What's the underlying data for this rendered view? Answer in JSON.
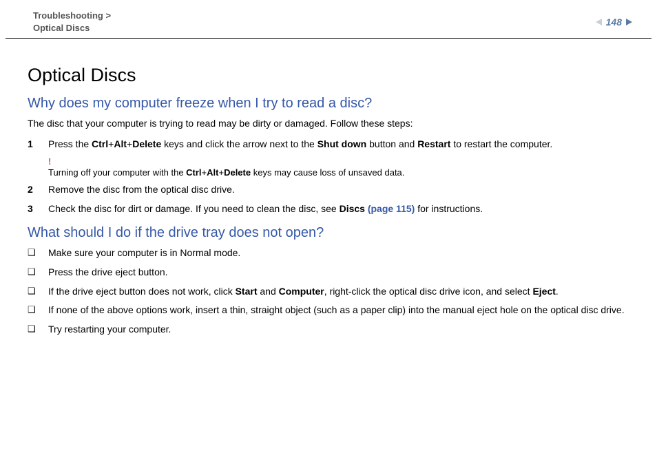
{
  "header": {
    "breadcrumb_parent": "Troubleshooting",
    "breadcrumb_sep": " >",
    "breadcrumb_current": "Optical Discs",
    "page_number": "148"
  },
  "section_title": "Optical Discs",
  "q1": {
    "heading": "Why does my computer freeze when I try to read a disc?",
    "intro": "The disc that your computer is trying to read may be dirty or damaged. Follow these steps:",
    "steps": {
      "s1": {
        "num": "1",
        "pre": "Press the ",
        "k1": "Ctrl",
        "plus1": "+",
        "k2": "Alt",
        "plus2": "+",
        "k3": "Delete",
        "mid1": " keys and click the arrow next to the ",
        "b1": "Shut down",
        "mid2": " button and ",
        "b2": "Restart",
        "post": " to restart the computer."
      },
      "warning": {
        "bang": "!",
        "pre": "Turning off your computer with the ",
        "k1": "Ctrl",
        "plus1": "+",
        "k2": "Alt",
        "plus2": "+",
        "k3": "Delete",
        "post": " keys may cause loss of unsaved data."
      },
      "s2": {
        "num": "2",
        "text": "Remove the disc from the optical disc drive."
      },
      "s3": {
        "num": "3",
        "pre": "Check the disc for dirt or damage. If you need to clean the disc, see ",
        "link_label": "Discs ",
        "link_page": "(page 115)",
        "post": " for instructions."
      }
    }
  },
  "q2": {
    "heading": "What should I do if the drive tray does not open?",
    "items": {
      "i1": "Make sure your computer is in Normal mode.",
      "i2": "Press the drive eject button.",
      "i3": {
        "pre": "If the drive eject button does not work, click ",
        "b1": "Start",
        "mid1": " and ",
        "b2": "Computer",
        "mid2": ", right-click the optical disc drive icon, and select ",
        "b3": "Eject",
        "post": "."
      },
      "i4": "If none of the above options work, insert a thin, straight object (such as a paper clip) into the manual eject hole on the optical disc drive.",
      "i5": "Try restarting your computer."
    }
  },
  "bullet_glyph": "❑"
}
